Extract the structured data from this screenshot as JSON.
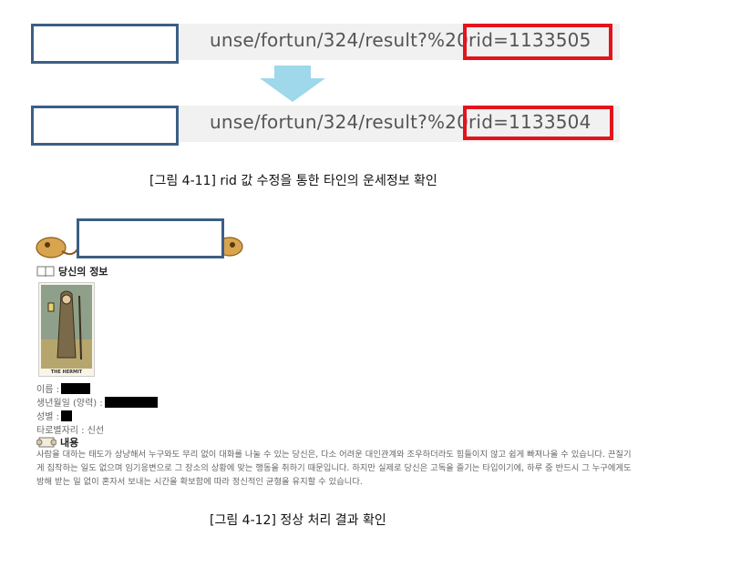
{
  "figure_1": {
    "url_before": "unse/fortun/324/result?%20rid=1133505",
    "url_after": "unse/fortun/324/result?%20rid=1133504",
    "caption": "[그림 4-11] rid 값 수정을 통한 타인의 운세정보 확인"
  },
  "figure_2": {
    "profile_header": "당신의 정보",
    "card_label": "THE HERMIT",
    "fields": {
      "name_label": "이름 :",
      "birth_label": "생년월일 (양력) :",
      "gender_label": "성별 :",
      "tarot_label": "타로별자리 : 신선"
    },
    "content_header": "내용",
    "content_text": "사람을 대하는 태도가 상냥해서 누구와도 무리 없이 대화를 나눌 수 있는 당신은, 다소 어려운 대인관계와 조우하더라도 힘들이지 않고 쉽게 빠져나올 수 있습니다. 끈질기게 집착하는 일도 없으며 임기응변으로 그 장소의 상황에 맞는 행동을 취하기 때문입니다. 하지만 실제로 당신은 고독을 즐기는 타입이기에, 하루 중 반드시 그 누구에게도 방해 받는 일 없이 혼자서 보내는 시간을 확보함에 따라 정신적인 균형을 유지할 수 있습니다.",
    "caption": "[그림 4-12] 정상 처리 결과 확인"
  },
  "colors": {
    "highlight_red": "#e3141b",
    "mask_border": "#3b5f85",
    "arrow": "#9ed8ea"
  }
}
